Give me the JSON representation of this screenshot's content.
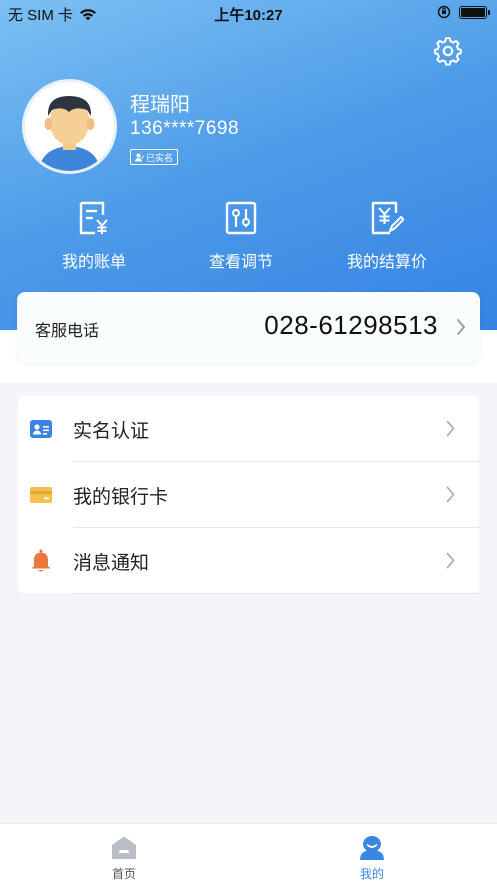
{
  "status_bar": {
    "carrier": "无 SIM 卡",
    "time": "上午10:27"
  },
  "profile": {
    "name": "程瑞阳",
    "phone": "136****7698",
    "verified_badge": "已实名"
  },
  "quick_menu": [
    {
      "label": "我的账单",
      "icon": "bill-icon"
    },
    {
      "label": "查看调节",
      "icon": "adjust-icon"
    },
    {
      "label": "我的结算价",
      "icon": "settlement-icon"
    }
  ],
  "service": {
    "label": "客服电话",
    "number": "028-61298513"
  },
  "menu": [
    {
      "label": "实名认证",
      "icon": "id-card-icon",
      "color": "#3b82e4"
    },
    {
      "label": "我的银行卡",
      "icon": "bank-card-icon",
      "color": "#f2c14e"
    },
    {
      "label": "消息通知",
      "icon": "bell-icon",
      "color": "#e8793a"
    }
  ],
  "tabs": [
    {
      "label": "首页",
      "icon": "home-icon",
      "active": false
    },
    {
      "label": "我的",
      "icon": "profile-icon",
      "active": true
    }
  ],
  "colors": {
    "accent": "#3a86e2",
    "header_gradient_start": "#7cc0f3",
    "header_gradient_end": "#2f7ee3"
  }
}
